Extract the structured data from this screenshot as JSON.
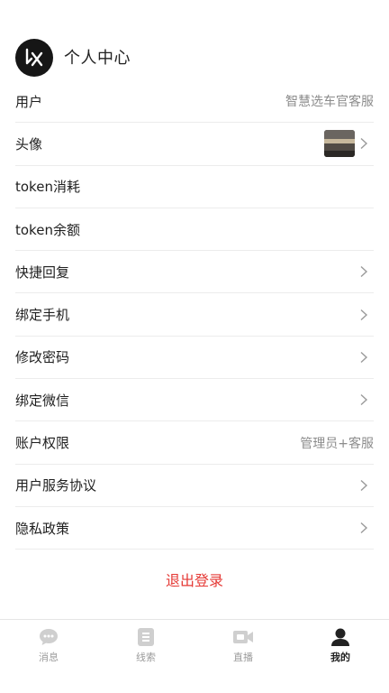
{
  "header": {
    "title": "个人中心",
    "logo_icon": "brand-logo-icon"
  },
  "rows": [
    {
      "label": "用户",
      "value": "智慧选车官客服",
      "chevron": false
    },
    {
      "label": "头像",
      "value": "",
      "chevron": true,
      "thumbnail": true
    },
    {
      "label": "token消耗",
      "value": "",
      "chevron": false
    },
    {
      "label": "token余额",
      "value": "",
      "chevron": false
    },
    {
      "label": "快捷回复",
      "value": "",
      "chevron": true
    },
    {
      "label": "绑定手机",
      "value": "",
      "chevron": true
    },
    {
      "label": "修改密码",
      "value": "",
      "chevron": true
    },
    {
      "label": "绑定微信",
      "value": "",
      "chevron": true
    },
    {
      "label": "账户权限",
      "value": "管理员+客服",
      "chevron": false
    },
    {
      "label": "用户服务协议",
      "value": "",
      "chevron": true
    },
    {
      "label": "隐私政策",
      "value": "",
      "chevron": true
    }
  ],
  "logout_label": "退出登录",
  "tabs": [
    {
      "label": "消息",
      "icon": "chat-bubble-icon",
      "active": false
    },
    {
      "label": "线索",
      "icon": "list-doc-icon",
      "active": false
    },
    {
      "label": "直播",
      "icon": "video-camera-icon",
      "active": false
    },
    {
      "label": "我的",
      "icon": "person-icon",
      "active": true
    }
  ],
  "colors": {
    "logout": "#e53935",
    "muted": "#8c8c8c",
    "divider": "#ececec",
    "tab_inactive": "#cfcfcf",
    "tab_active": "#222222"
  }
}
